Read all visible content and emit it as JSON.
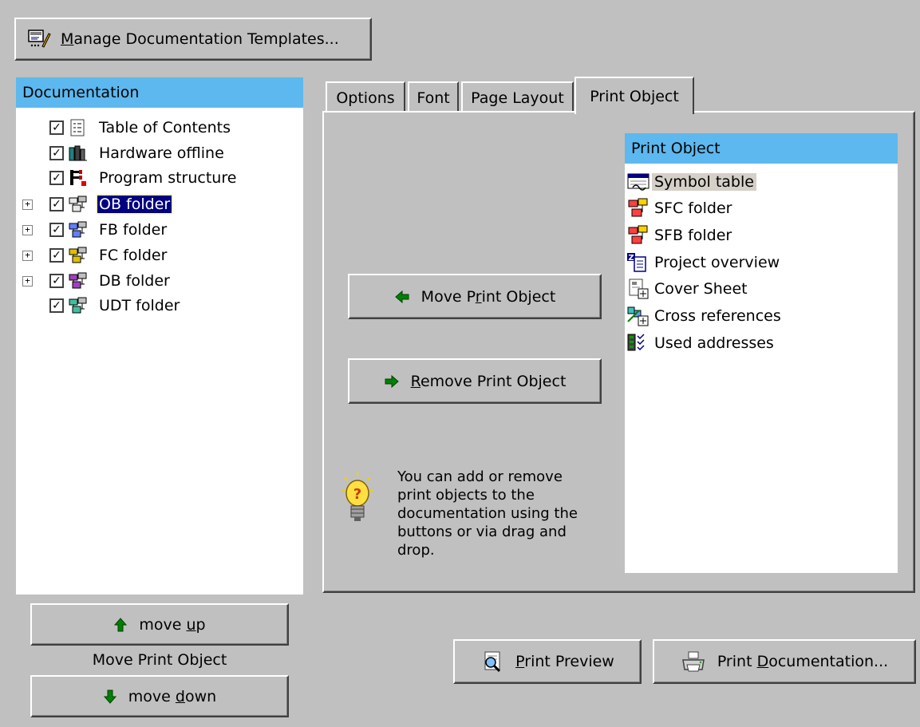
{
  "manage_templates_button": {
    "label": "Manage Documentation Templates...",
    "icon": "template-edit-icon"
  },
  "documentation_panel": {
    "header": "Documentation",
    "items": [
      {
        "label": "Table of Contents",
        "checked": true,
        "expandable": false,
        "icon": "table-of-contents-icon",
        "selected": false
      },
      {
        "label": "Hardware offline",
        "checked": true,
        "expandable": false,
        "icon": "hardware-icon",
        "selected": false
      },
      {
        "label": "Program structure",
        "checked": true,
        "expandable": false,
        "icon": "program-structure-icon",
        "selected": false
      },
      {
        "label": "OB folder",
        "checked": true,
        "expandable": true,
        "icon": "ob-folder-icon",
        "selected": true
      },
      {
        "label": "FB folder",
        "checked": true,
        "expandable": true,
        "icon": "fb-folder-icon",
        "selected": false
      },
      {
        "label": "FC folder",
        "checked": true,
        "expandable": true,
        "icon": "fc-folder-icon",
        "selected": false
      },
      {
        "label": "DB folder",
        "checked": true,
        "expandable": true,
        "icon": "db-folder-icon",
        "selected": false
      },
      {
        "label": "UDT folder",
        "checked": true,
        "expandable": false,
        "icon": "udt-folder-icon",
        "selected": false
      }
    ]
  },
  "tabs": [
    {
      "label": "Options",
      "active": false
    },
    {
      "label": "Font",
      "active": false
    },
    {
      "label": "Page Layout",
      "active": false
    },
    {
      "label": "Print Object",
      "active": true
    }
  ],
  "print_object_tab": {
    "move_button": {
      "label_before": "Move P",
      "label_u": "r",
      "label_after": "int Object",
      "icon": "arrow-left-icon"
    },
    "remove_button": {
      "label_before": "",
      "label_u": "R",
      "label_after": "emove Print Object",
      "icon": "arrow-right-icon"
    },
    "hint_text": "You can add or remove print objects to the documentation using the buttons or via drag and drop.",
    "hint_icon": "lightbulb-icon",
    "list_header": "Print Object",
    "list_items": [
      {
        "label": "Symbol table",
        "icon": "symbol-table-icon",
        "highlighted": true
      },
      {
        "label": "SFC folder",
        "icon": "sfc-folder-icon",
        "highlighted": false
      },
      {
        "label": "SFB folder",
        "icon": "sfb-folder-icon",
        "highlighted": false
      },
      {
        "label": "Project overview",
        "icon": "project-overview-icon",
        "highlighted": false
      },
      {
        "label": "Cover Sheet",
        "icon": "cover-sheet-icon",
        "highlighted": false
      },
      {
        "label": "Cross references",
        "icon": "cross-references-icon",
        "highlighted": false
      },
      {
        "label": "Used addresses",
        "icon": "used-addresses-icon",
        "highlighted": false
      }
    ]
  },
  "move_up_button": {
    "label_before": "move ",
    "label_u": "u",
    "label_after": "p",
    "icon": "arrow-up-icon"
  },
  "move_print_object_label": "Move Print Object",
  "move_down_button": {
    "label_before": "move ",
    "label_u": "d",
    "label_after": "own",
    "icon": "arrow-down-icon"
  },
  "print_preview_button": {
    "label_before": "",
    "label_u": "P",
    "label_after": "rint Preview",
    "icon": "print-preview-icon"
  },
  "print_documentation_button": {
    "label_before": "Print ",
    "label_u": "D",
    "label_after": "ocumentation...",
    "icon": "printer-icon"
  },
  "colors": {
    "face": "#c0c0c0",
    "header": "#5cb8ee",
    "selection": "#000080",
    "arrow_green": "#008000"
  }
}
